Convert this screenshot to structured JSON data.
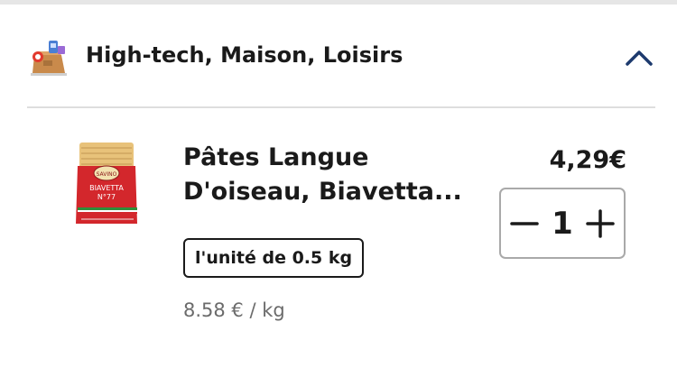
{
  "category": {
    "title": "High-tech, Maison, Loisirs",
    "icon": "box-with-items-icon",
    "toggle_icon": "chevron-up-icon",
    "accent_color": "#1d3a6e"
  },
  "product": {
    "name_line1": "Pâtes Langue",
    "name_line2": "D'oiseau, Biavetta...",
    "image": "pasta-package-icon",
    "package_brand": "SAVINO",
    "package_name": "BIAVETTA",
    "package_number": "N°77",
    "unit_label": "l'unité de 0.5 kg",
    "price": "4,29€",
    "price_per_kg": "8.58 € / kg",
    "quantity": "1",
    "minus_icon": "minus-icon",
    "plus_icon": "plus-icon"
  }
}
